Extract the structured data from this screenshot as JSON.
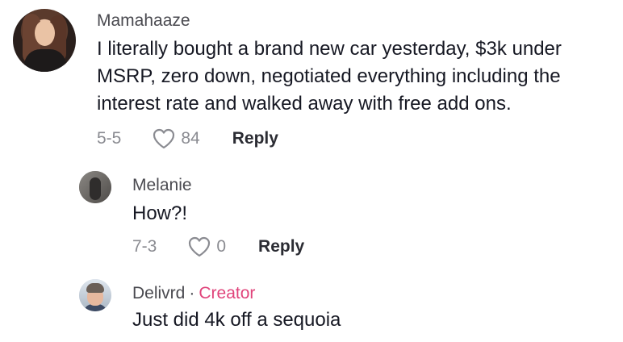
{
  "comments": [
    {
      "username": "Mamahaaze",
      "text_lines": [
        "I literally bought a brand new car yesterday, $3k under",
        "MSRP, zero down, negotiated everything including the",
        "interest rate and walked away with free add ons."
      ],
      "date": "5-5",
      "likes": "84",
      "reply_label": "Reply"
    },
    {
      "username": "Melanie",
      "text": "How?!",
      "date": "7-3",
      "likes": "0",
      "reply_label": "Reply"
    },
    {
      "username": "Delivrd",
      "separator": "·",
      "badge": "Creator",
      "text": "Just did 4k off a sequoia"
    }
  ],
  "icons": {
    "like": "heart-outline-icon"
  },
  "colors": {
    "creator_badge": "#e0447b",
    "meta": "#8a8b91"
  }
}
